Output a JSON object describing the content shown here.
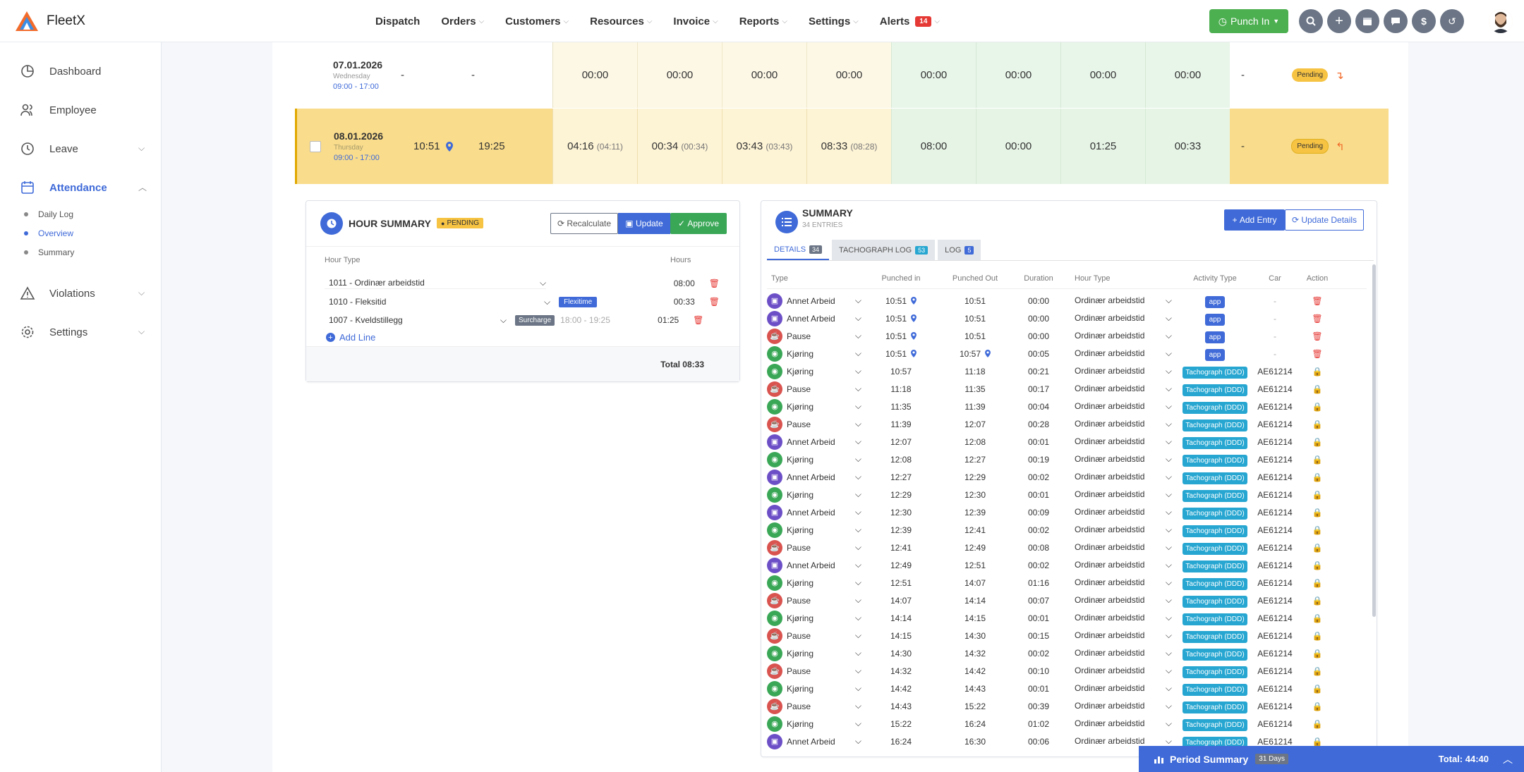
{
  "app": {
    "name": "FleetX"
  },
  "nav": {
    "items": [
      "Dispatch",
      "Orders",
      "Customers",
      "Resources",
      "Invoice",
      "Reports",
      "Settings",
      "Alerts"
    ],
    "alerts_count": "14",
    "punch_label": "Punch In"
  },
  "header_icons": [
    "search-icon",
    "plus-icon",
    "calendar-icon",
    "chat-icon",
    "dollar-icon",
    "history-icon"
  ],
  "sidebar": {
    "items": [
      {
        "label": "Dashboard",
        "icon": "pie-chart-icon"
      },
      {
        "label": "Employee",
        "icon": "users-icon"
      },
      {
        "label": "Leave",
        "icon": "clock-icon"
      },
      {
        "label": "Attendance",
        "icon": "calendar-icon"
      },
      {
        "label": "Violations",
        "icon": "warning-icon"
      },
      {
        "label": "Settings",
        "icon": "gear-icon"
      }
    ],
    "attendance_sub": [
      "Daily Log",
      "Overview",
      "Summary"
    ]
  },
  "days": [
    {
      "date": "07.01.2026",
      "weekday": "Wednesday",
      "shift": "09:00 - 17:00",
      "in": "-",
      "out": "-",
      "c1": "00:00",
      "c1s": "",
      "c2": "00:00",
      "c2s": "",
      "c3": "00:00",
      "c3s": "",
      "c4": "00:00",
      "c4s": "",
      "g1": "00:00",
      "g2": "00:00",
      "g3": "00:00",
      "g4": "00:00",
      "dash": "-",
      "status": "Pending"
    },
    {
      "date": "08.01.2026",
      "weekday": "Thursday",
      "shift": "09:00 - 17:00",
      "in": "10:51",
      "out": "19:25",
      "c1": "04:16",
      "c1s": "(04:11)",
      "c2": "00:34",
      "c2s": "(00:34)",
      "c3": "03:43",
      "c3s": "(03:43)",
      "c4": "08:33",
      "c4s": "(08:28)",
      "g1": "08:00",
      "g2": "00:00",
      "g3": "01:25",
      "g4": "00:33",
      "dash": "-",
      "status": "Pending"
    }
  ],
  "hour_summary": {
    "title": "HOUR SUMMARY",
    "status": "PENDING",
    "buttons": {
      "recalc": "Recalculate",
      "update": "Update",
      "approve": "Approve"
    },
    "col_type": "Hour Type",
    "col_hours": "Hours",
    "lines": [
      {
        "type": "1011 - Ordinær arbeidstid",
        "tag": "",
        "range": "",
        "hours": "08:00"
      },
      {
        "type": "1010 - Fleksitid",
        "tag": "Flexitime",
        "range": "",
        "hours": "00:33"
      },
      {
        "type": "1007 - Kveldstillegg",
        "tag": "Surcharge",
        "range": "18:00 - 19:25",
        "hours": "01:25"
      }
    ],
    "add_line": "Add Line",
    "total": "Total 08:33"
  },
  "summary": {
    "title": "SUMMARY",
    "subtitle": "34 ENTRIES",
    "add_entry": "Add Entry",
    "update_details": "Update Details",
    "tabs": [
      {
        "label": "DETAILS",
        "count": "34"
      },
      {
        "label": "TACHOGRAPH LOG",
        "count": "53"
      },
      {
        "label": "LOG",
        "count": "5"
      }
    ],
    "headers": [
      "Type",
      "Punched in",
      "Punched Out",
      "Duration",
      "Hour Type",
      "Activity Type",
      "Car",
      "Action"
    ],
    "rows": [
      {
        "type": "Annet Arbeid",
        "kind": "work",
        "in": "10:51",
        "in_pin": true,
        "out": "10:51",
        "out_pin": false,
        "dur": "00:00",
        "hour": "Ordinær arbeidstid",
        "act": "app",
        "car": "-",
        "locked": false
      },
      {
        "type": "Annet Arbeid",
        "kind": "work",
        "in": "10:51",
        "in_pin": true,
        "out": "10:51",
        "out_pin": false,
        "dur": "00:00",
        "hour": "Ordinær arbeidstid",
        "act": "app",
        "car": "-",
        "locked": false
      },
      {
        "type": "Pause",
        "kind": "pause",
        "in": "10:51",
        "in_pin": true,
        "out": "10:51",
        "out_pin": false,
        "dur": "00:00",
        "hour": "Ordinær arbeidstid",
        "act": "app",
        "car": "-",
        "locked": false
      },
      {
        "type": "Kjøring",
        "kind": "drive",
        "in": "10:51",
        "in_pin": true,
        "out": "10:57",
        "out_pin": true,
        "dur": "00:05",
        "hour": "Ordinær arbeidstid",
        "act": "app",
        "car": "-",
        "locked": false
      },
      {
        "type": "Kjøring",
        "kind": "drive",
        "in": "10:57",
        "in_pin": false,
        "out": "11:18",
        "out_pin": false,
        "dur": "00:21",
        "hour": "Ordinær arbeidstid",
        "act": "Tachograph (DDD)",
        "car": "AE61214",
        "locked": true
      },
      {
        "type": "Pause",
        "kind": "pause",
        "in": "11:18",
        "in_pin": false,
        "out": "11:35",
        "out_pin": false,
        "dur": "00:17",
        "hour": "Ordinær arbeidstid",
        "act": "Tachograph (DDD)",
        "car": "AE61214",
        "locked": true
      },
      {
        "type": "Kjøring",
        "kind": "drive",
        "in": "11:35",
        "in_pin": false,
        "out": "11:39",
        "out_pin": false,
        "dur": "00:04",
        "hour": "Ordinær arbeidstid",
        "act": "Tachograph (DDD)",
        "car": "AE61214",
        "locked": true
      },
      {
        "type": "Pause",
        "kind": "pause",
        "in": "11:39",
        "in_pin": false,
        "out": "12:07",
        "out_pin": false,
        "dur": "00:28",
        "hour": "Ordinær arbeidstid",
        "act": "Tachograph (DDD)",
        "car": "AE61214",
        "locked": true
      },
      {
        "type": "Annet Arbeid",
        "kind": "work",
        "in": "12:07",
        "in_pin": false,
        "out": "12:08",
        "out_pin": false,
        "dur": "00:01",
        "hour": "Ordinær arbeidstid",
        "act": "Tachograph (DDD)",
        "car": "AE61214",
        "locked": true
      },
      {
        "type": "Kjøring",
        "kind": "drive",
        "in": "12:08",
        "in_pin": false,
        "out": "12:27",
        "out_pin": false,
        "dur": "00:19",
        "hour": "Ordinær arbeidstid",
        "act": "Tachograph (DDD)",
        "car": "AE61214",
        "locked": true
      },
      {
        "type": "Annet Arbeid",
        "kind": "work",
        "in": "12:27",
        "in_pin": false,
        "out": "12:29",
        "out_pin": false,
        "dur": "00:02",
        "hour": "Ordinær arbeidstid",
        "act": "Tachograph (DDD)",
        "car": "AE61214",
        "locked": true
      },
      {
        "type": "Kjøring",
        "kind": "drive",
        "in": "12:29",
        "in_pin": false,
        "out": "12:30",
        "out_pin": false,
        "dur": "00:01",
        "hour": "Ordinær arbeidstid",
        "act": "Tachograph (DDD)",
        "car": "AE61214",
        "locked": true
      },
      {
        "type": "Annet Arbeid",
        "kind": "work",
        "in": "12:30",
        "in_pin": false,
        "out": "12:39",
        "out_pin": false,
        "dur": "00:09",
        "hour": "Ordinær arbeidstid",
        "act": "Tachograph (DDD)",
        "car": "AE61214",
        "locked": true
      },
      {
        "type": "Kjøring",
        "kind": "drive",
        "in": "12:39",
        "in_pin": false,
        "out": "12:41",
        "out_pin": false,
        "dur": "00:02",
        "hour": "Ordinær arbeidstid",
        "act": "Tachograph (DDD)",
        "car": "AE61214",
        "locked": true
      },
      {
        "type": "Pause",
        "kind": "pause",
        "in": "12:41",
        "in_pin": false,
        "out": "12:49",
        "out_pin": false,
        "dur": "00:08",
        "hour": "Ordinær arbeidstid",
        "act": "Tachograph (DDD)",
        "car": "AE61214",
        "locked": true
      },
      {
        "type": "Annet Arbeid",
        "kind": "work",
        "in": "12:49",
        "in_pin": false,
        "out": "12:51",
        "out_pin": false,
        "dur": "00:02",
        "hour": "Ordinær arbeidstid",
        "act": "Tachograph (DDD)",
        "car": "AE61214",
        "locked": true
      },
      {
        "type": "Kjøring",
        "kind": "drive",
        "in": "12:51",
        "in_pin": false,
        "out": "14:07",
        "out_pin": false,
        "dur": "01:16",
        "hour": "Ordinær arbeidstid",
        "act": "Tachograph (DDD)",
        "car": "AE61214",
        "locked": true
      },
      {
        "type": "Pause",
        "kind": "pause",
        "in": "14:07",
        "in_pin": false,
        "out": "14:14",
        "out_pin": false,
        "dur": "00:07",
        "hour": "Ordinær arbeidstid",
        "act": "Tachograph (DDD)",
        "car": "AE61214",
        "locked": true
      },
      {
        "type": "Kjøring",
        "kind": "drive",
        "in": "14:14",
        "in_pin": false,
        "out": "14:15",
        "out_pin": false,
        "dur": "00:01",
        "hour": "Ordinær arbeidstid",
        "act": "Tachograph (DDD)",
        "car": "AE61214",
        "locked": true
      },
      {
        "type": "Pause",
        "kind": "pause",
        "in": "14:15",
        "in_pin": false,
        "out": "14:30",
        "out_pin": false,
        "dur": "00:15",
        "hour": "Ordinær arbeidstid",
        "act": "Tachograph (DDD)",
        "car": "AE61214",
        "locked": true
      },
      {
        "type": "Kjøring",
        "kind": "drive",
        "in": "14:30",
        "in_pin": false,
        "out": "14:32",
        "out_pin": false,
        "dur": "00:02",
        "hour": "Ordinær arbeidstid",
        "act": "Tachograph (DDD)",
        "car": "AE61214",
        "locked": true
      },
      {
        "type": "Pause",
        "kind": "pause",
        "in": "14:32",
        "in_pin": false,
        "out": "14:42",
        "out_pin": false,
        "dur": "00:10",
        "hour": "Ordinær arbeidstid",
        "act": "Tachograph (DDD)",
        "car": "AE61214",
        "locked": true
      },
      {
        "type": "Kjøring",
        "kind": "drive",
        "in": "14:42",
        "in_pin": false,
        "out": "14:43",
        "out_pin": false,
        "dur": "00:01",
        "hour": "Ordinær arbeidstid",
        "act": "Tachograph (DDD)",
        "car": "AE61214",
        "locked": true
      },
      {
        "type": "Pause",
        "kind": "pause",
        "in": "14:43",
        "in_pin": false,
        "out": "15:22",
        "out_pin": false,
        "dur": "00:39",
        "hour": "Ordinær arbeidstid",
        "act": "Tachograph (DDD)",
        "car": "AE61214",
        "locked": true
      },
      {
        "type": "Kjøring",
        "kind": "drive",
        "in": "15:22",
        "in_pin": false,
        "out": "16:24",
        "out_pin": false,
        "dur": "01:02",
        "hour": "Ordinær arbeidstid",
        "act": "Tachograph (DDD)",
        "car": "AE61214",
        "locked": true
      },
      {
        "type": "Annet Arbeid",
        "kind": "work",
        "in": "16:24",
        "in_pin": false,
        "out": "16:30",
        "out_pin": false,
        "dur": "00:06",
        "hour": "Ordinær arbeidstid",
        "act": "Tachograph (DDD)",
        "car": "AE61214",
        "locked": true
      }
    ]
  },
  "period_summary": {
    "label": "Period Summary",
    "days": "31 Days",
    "total": "Total: 44:40"
  },
  "colors": {
    "accent": "#3f6ad8",
    "work": "#6c4fc7",
    "drive": "#3aa757",
    "pause": "#d9534f",
    "pending": "#f6c343",
    "row_highlight": "#f9dc8c"
  }
}
